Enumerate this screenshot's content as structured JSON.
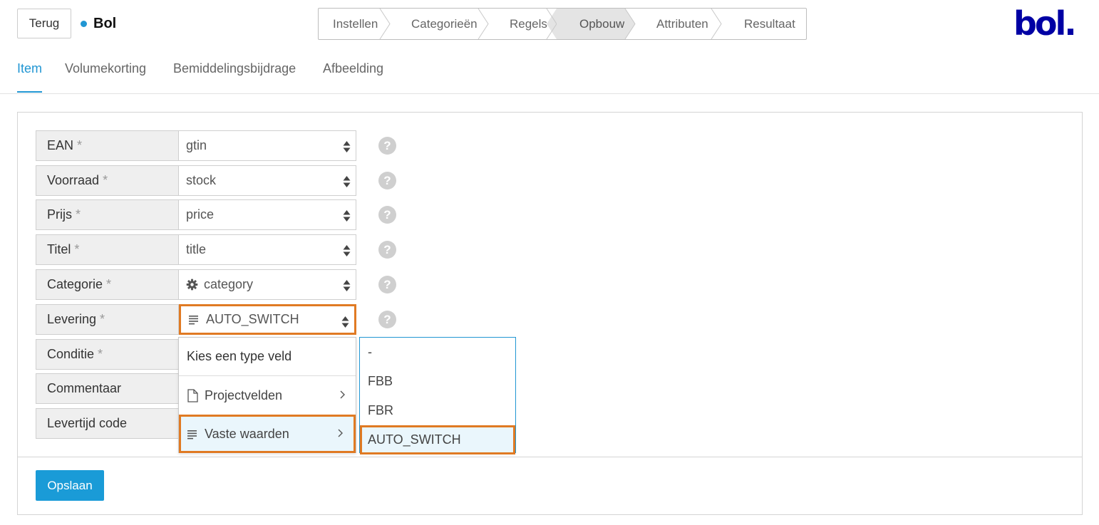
{
  "header": {
    "back_label": "Terug",
    "channel_name": "Bol",
    "channel_dot_color": "#2196d3",
    "logo_text": "bol.",
    "logo_color": "#0000a4"
  },
  "wizard": {
    "steps": [
      {
        "label": "Instellen",
        "active": false
      },
      {
        "label": "Categorieën",
        "active": false
      },
      {
        "label": "Regels",
        "active": false
      },
      {
        "label": "Opbouw",
        "active": true
      },
      {
        "label": "Attributen",
        "active": false
      },
      {
        "label": "Resultaat",
        "active": false
      }
    ]
  },
  "tabs": [
    {
      "label": "Item",
      "active": true
    },
    {
      "label": "Volumekorting",
      "active": false
    },
    {
      "label": "Bemiddelingsbijdrage",
      "active": false
    },
    {
      "label": "Afbeelding",
      "active": false
    }
  ],
  "form": {
    "required_mark": "*",
    "help_glyph": "?",
    "rows": [
      {
        "label": "EAN",
        "required": true,
        "value": "gtin",
        "icon": "none"
      },
      {
        "label": "Voorraad",
        "required": true,
        "value": "stock",
        "icon": "none"
      },
      {
        "label": "Prijs",
        "required": true,
        "value": "price",
        "icon": "none"
      },
      {
        "label": "Titel",
        "required": true,
        "value": "title",
        "icon": "none"
      },
      {
        "label": "Categorie",
        "required": true,
        "value": "category",
        "icon": "gear-icon"
      },
      {
        "label": "Levering",
        "required": true,
        "value": "AUTO_SWITCH",
        "icon": "lines-icon"
      },
      {
        "label": "Conditie",
        "required": true,
        "value": "",
        "icon": "none"
      },
      {
        "label": "Commentaar",
        "required": false,
        "value": "",
        "icon": "none"
      },
      {
        "label": "Levertijd code",
        "required": false,
        "value": "",
        "icon": "none"
      }
    ]
  },
  "field_type_menu": {
    "heading": "Kies een type veld",
    "items": [
      {
        "label": "Projectvelden",
        "icon": "file-icon"
      },
      {
        "label": "Vaste waarden",
        "icon": "lines-icon",
        "selected": true
      }
    ]
  },
  "fixed_values_menu": {
    "options": [
      "-",
      "FBB",
      "FBR",
      "AUTO_SWITCH"
    ],
    "selected": "AUTO_SWITCH"
  },
  "footer": {
    "save_label": "Opslaan"
  },
  "colors": {
    "accent": "#2196d3",
    "highlight": "#e07a23",
    "button": "#1a9bd7"
  }
}
